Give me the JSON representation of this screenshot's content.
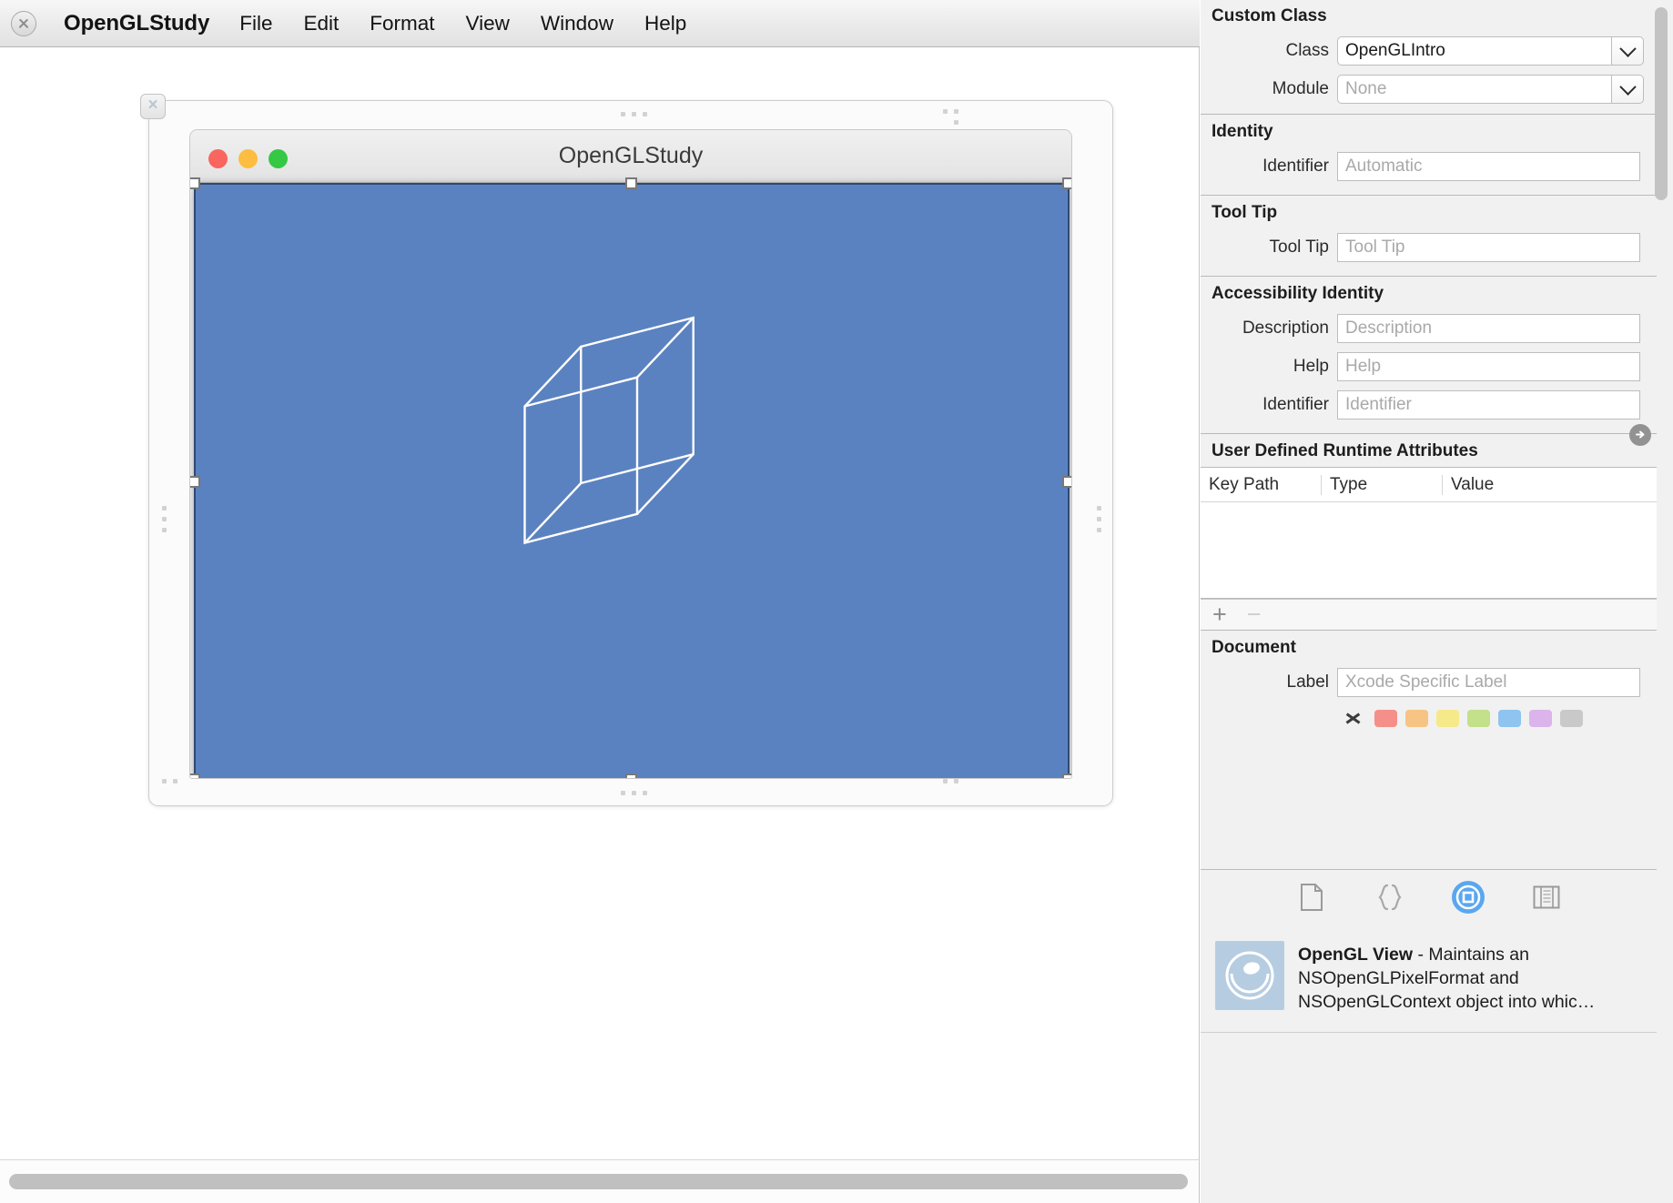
{
  "menubar": {
    "apple_icon": "apple-badge-icon",
    "app_name": "OpenGLStudy",
    "items": [
      "File",
      "Edit",
      "Format",
      "View",
      "Window",
      "Help"
    ]
  },
  "canvas": {
    "ib_window": {
      "close_badge": "×",
      "mac_window": {
        "title": "OpenGLStudy",
        "traffic_lights": [
          "close",
          "minimize",
          "zoom"
        ],
        "gl_view": {
          "background_color": "#5b82c0",
          "border_color": "#2e4a73",
          "content": "wireframe-cube",
          "wireframe_color": "#ffffff",
          "selected": true
        }
      }
    }
  },
  "inspector": {
    "custom_class": {
      "title": "Custom Class",
      "class_label": "Class",
      "class_value": "OpenGLIntro",
      "module_label": "Module",
      "module_placeholder": "None"
    },
    "identity": {
      "title": "Identity",
      "identifier_label": "Identifier",
      "identifier_placeholder": "Automatic"
    },
    "tool_tip": {
      "title": "Tool Tip",
      "label": "Tool Tip",
      "placeholder": "Tool Tip"
    },
    "accessibility": {
      "title": "Accessibility Identity",
      "description_label": "Description",
      "description_placeholder": "Description",
      "help_label": "Help",
      "help_placeholder": "Help",
      "identifier_label": "Identifier",
      "identifier_placeholder": "Identifier"
    },
    "runtime_attributes": {
      "title": "User Defined Runtime Attributes",
      "columns": [
        "Key Path",
        "Type",
        "Value"
      ],
      "rows": [],
      "add_button": "+",
      "remove_button": "−"
    },
    "document": {
      "title": "Document",
      "label_label": "Label",
      "label_placeholder": "Xcode Specific Label",
      "swatch_none": "no-color",
      "swatches": [
        "#f49089",
        "#f7c484",
        "#f5e98a",
        "#c3e08a",
        "#8ec4ef",
        "#dbb4ec",
        "#c9c9c9"
      ]
    },
    "library_tabs": [
      {
        "name": "file-template-library",
        "icon": "document-icon",
        "active": false
      },
      {
        "name": "code-snippet-library",
        "icon": "braces-icon",
        "active": false
      },
      {
        "name": "object-library",
        "icon": "circled-square-icon",
        "active": true
      },
      {
        "name": "media-library",
        "icon": "filmstrip-icon",
        "active": false
      }
    ],
    "library_detail": {
      "icon": "opengl-sphere-icon",
      "name": "OpenGL View",
      "description": " - Maintains an NSOpenGLPixelFormat and NSOpenGLContext object into whic…"
    }
  }
}
